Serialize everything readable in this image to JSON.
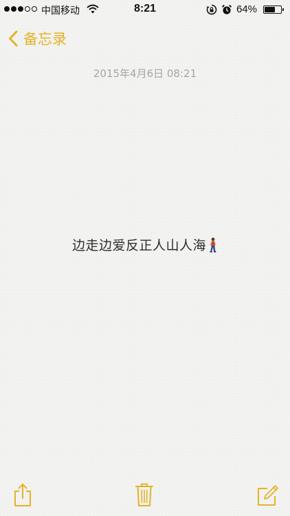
{
  "status_bar": {
    "carrier": "中国移动",
    "time": "8:21",
    "battery_percent": "64%",
    "battery_level": 0.64,
    "signal_bars_filled": 3,
    "signal_bars_total": 5,
    "icons": [
      "wifi-icon",
      "rotation-lock-icon",
      "alarm-icon",
      "battery-icon"
    ]
  },
  "nav": {
    "back_label": "备忘录",
    "accent_color": "#e4b324"
  },
  "note": {
    "date": "2015年4月6日 08:21",
    "text": "边走边爱反正人山人海",
    "trailing_icon": "walking-person-icon"
  },
  "toolbar": {
    "icons": [
      "share-icon",
      "trash-icon",
      "compose-icon"
    ]
  }
}
